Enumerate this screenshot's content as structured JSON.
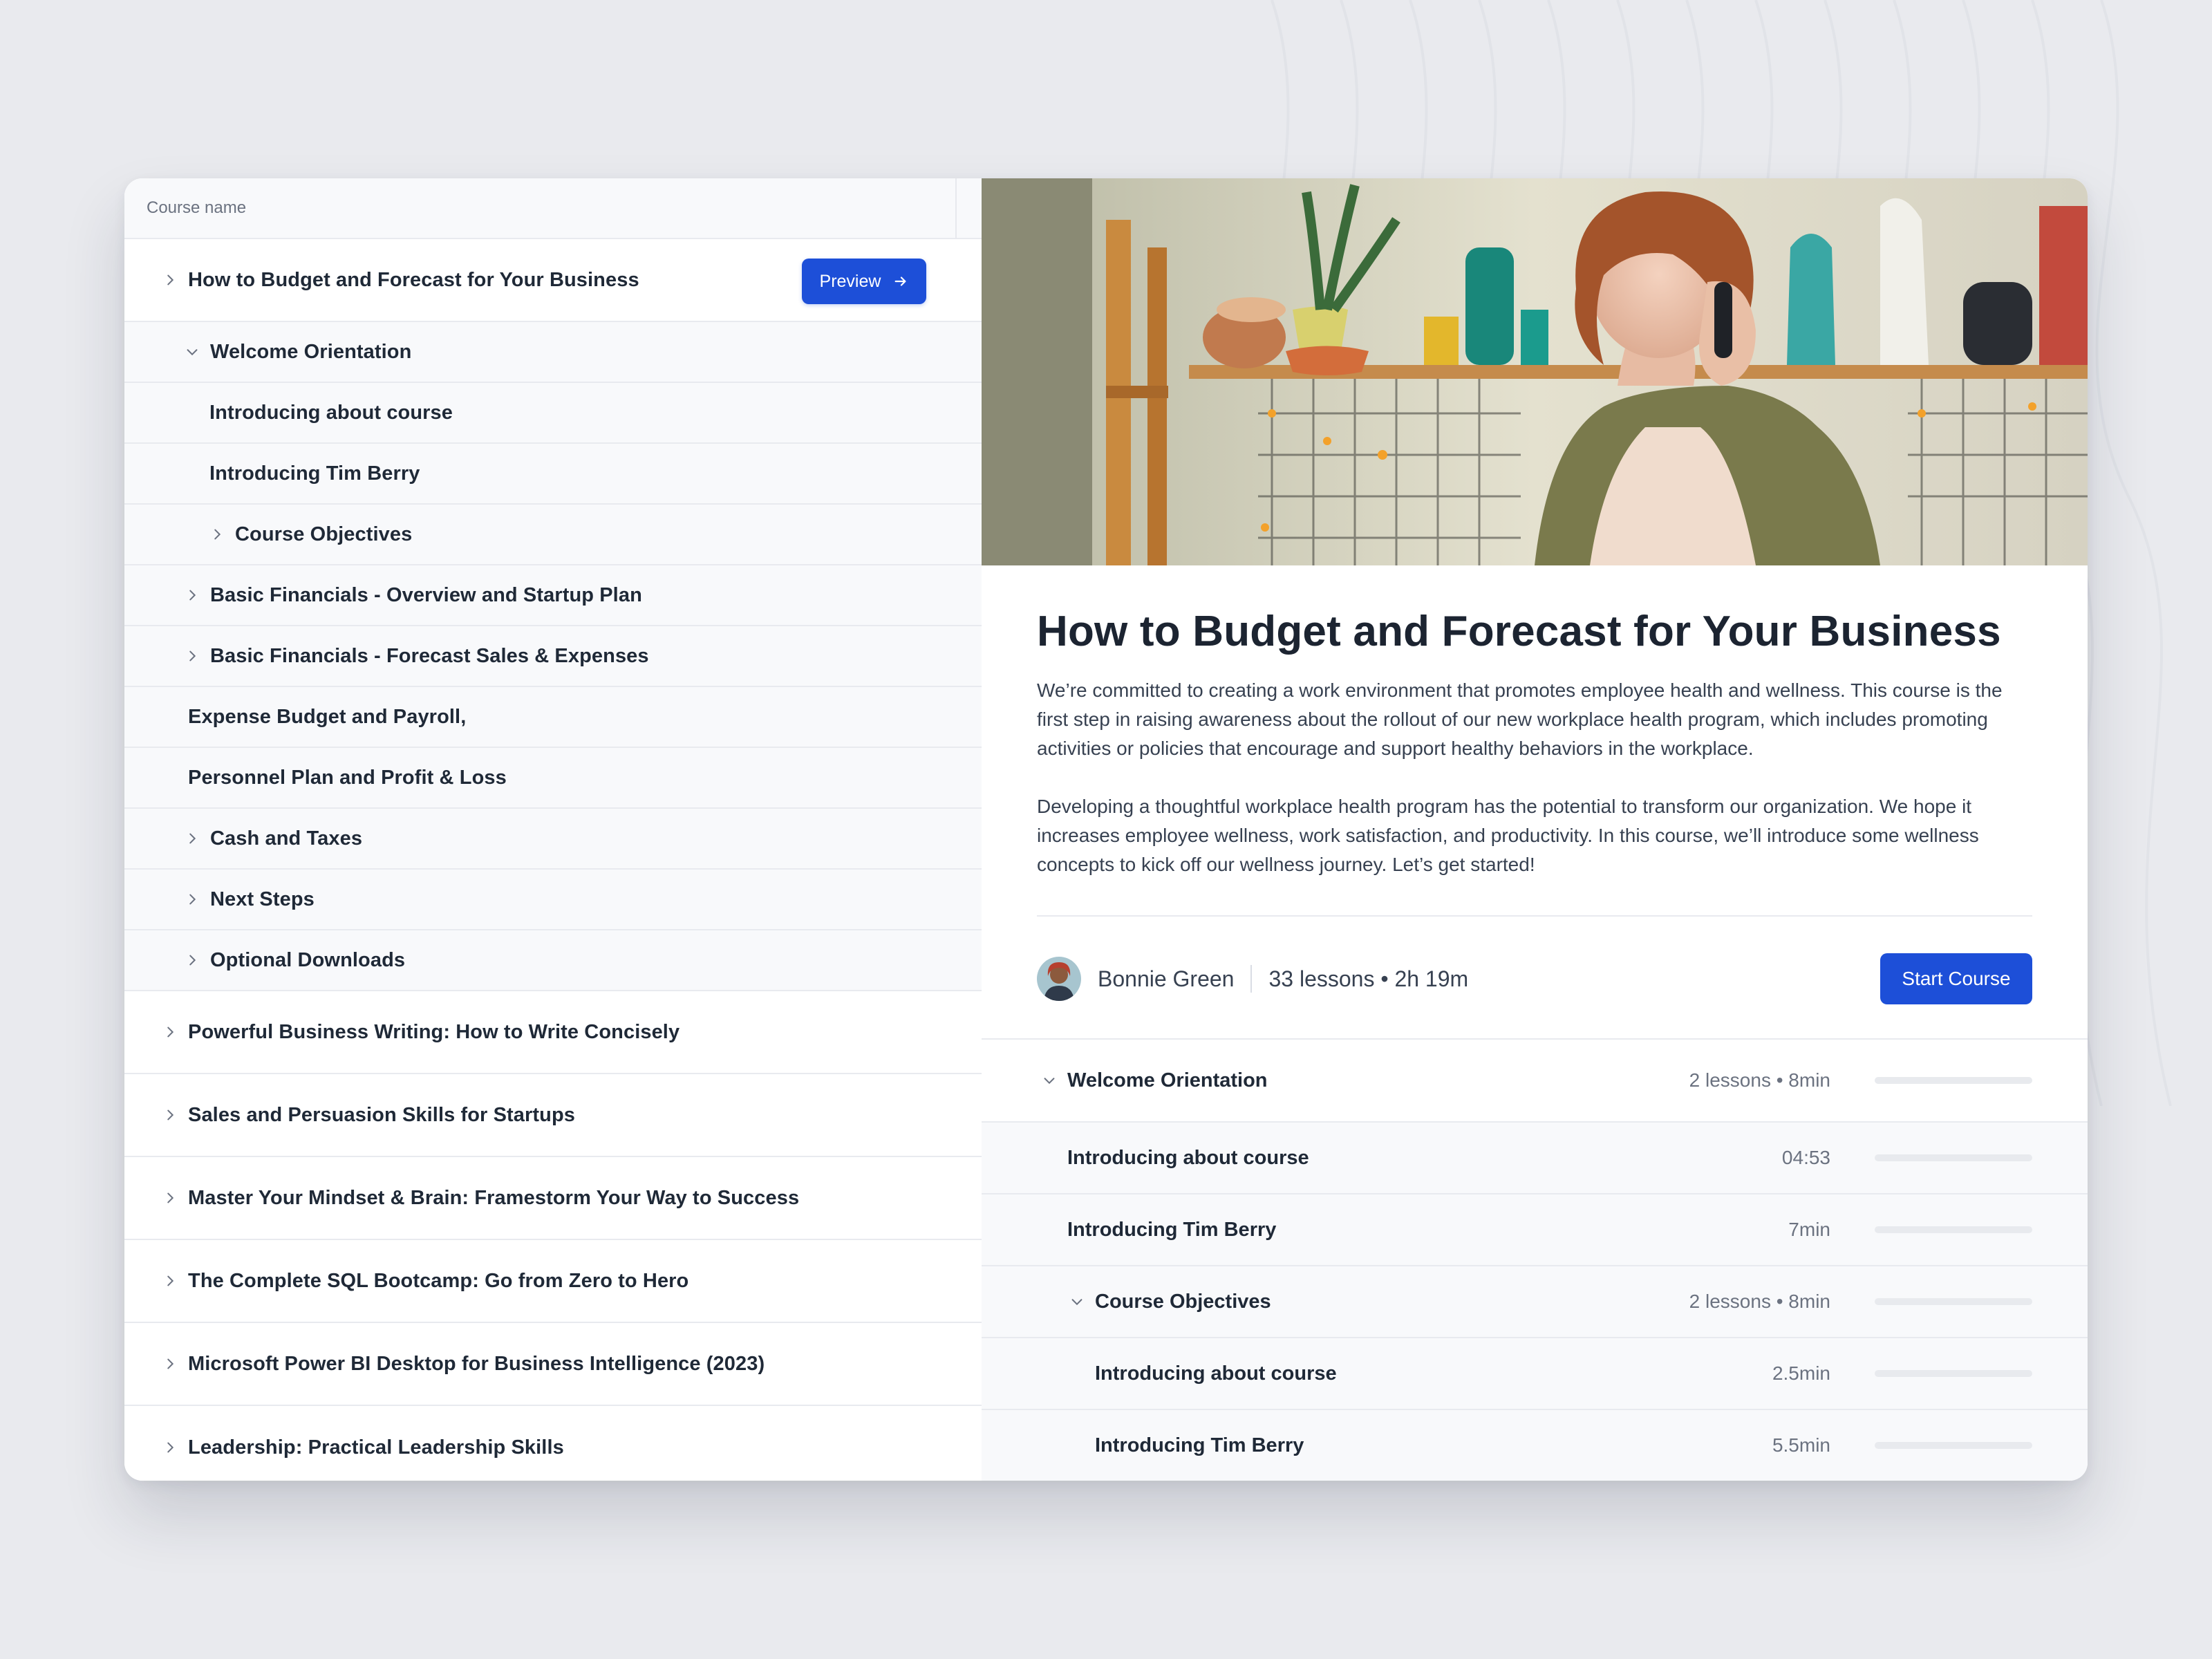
{
  "colors": {
    "accent": "#1d4fd8",
    "background": "#e9eaee",
    "panel": "#ffffff",
    "row_alt": "#f8f9fb"
  },
  "left": {
    "column_header": "Course name",
    "expanded_course": {
      "title": "How to Budget and Forecast for Your Business",
      "preview_label": "Preview",
      "preview_icon": "arrow-right-icon"
    },
    "sections": [
      {
        "label": "Welcome Orientation",
        "state": "expanded"
      },
      {
        "label": "Introducing about course"
      },
      {
        "label": "Introducing Tim Berry"
      },
      {
        "label": "Course Objectives",
        "state": "collapsed"
      },
      {
        "label": "Basic Financials - Overview and Startup Plan",
        "state": "collapsed"
      },
      {
        "label": "Basic Financials - Forecast Sales & Expenses",
        "state": "collapsed"
      },
      {
        "label": "Expense Budget and Payroll,"
      },
      {
        "label": "Personnel Plan and Profit & Loss"
      },
      {
        "label": "Cash and Taxes",
        "state": "collapsed"
      },
      {
        "label": "Next Steps",
        "state": "collapsed"
      },
      {
        "label": "Optional Downloads",
        "state": "collapsed"
      }
    ],
    "other_courses": [
      "Powerful Business Writing: How to Write Concisely",
      "Sales and Persuasion Skills for Startups",
      "Master Your Mindset & Brain: Framestorm Your Way to Success",
      "The Complete SQL Bootcamp: Go from Zero to Hero",
      "Microsoft Power BI Desktop for Business Intelligence (2023)",
      "Leadership: Practical Leadership Skills"
    ]
  },
  "detail": {
    "title": "How to Budget and Forecast for Your Business",
    "paragraphs": [
      "We’re committed to creating a work environment that promotes employee health and wellness. This course is the first step in raising awareness about the rollout of our new workplace health program, which includes promoting activities or policies that encourage and support healthy behaviors in the workplace.",
      "Developing a thoughtful workplace health program has the potential to transform our organization. We hope it increases employee wellness, work satisfaction, and productivity. In this course, we’ll introduce some wellness concepts to kick off our wellness journey. Let’s get started!"
    ],
    "author": "Bonnie Green",
    "stats": "33 lessons • 2h 19m",
    "start_label": "Start Course",
    "lessons": [
      {
        "name": "Welcome Orientation",
        "duration": "2 lessons  • 8min",
        "progress": 0
      },
      {
        "name": "Introducing about course",
        "duration": "04:53",
        "progress": 0
      },
      {
        "name": "Introducing Tim Berry",
        "duration": "7min",
        "progress": 0
      },
      {
        "name": "Course Objectives",
        "duration": "2 lessons  • 8min",
        "progress": 0
      },
      {
        "name": "Introducing about course",
        "duration": "2.5min",
        "progress": 0
      },
      {
        "name": "Introducing Tim Berry",
        "duration": "5.5min",
        "progress": 0
      }
    ]
  }
}
